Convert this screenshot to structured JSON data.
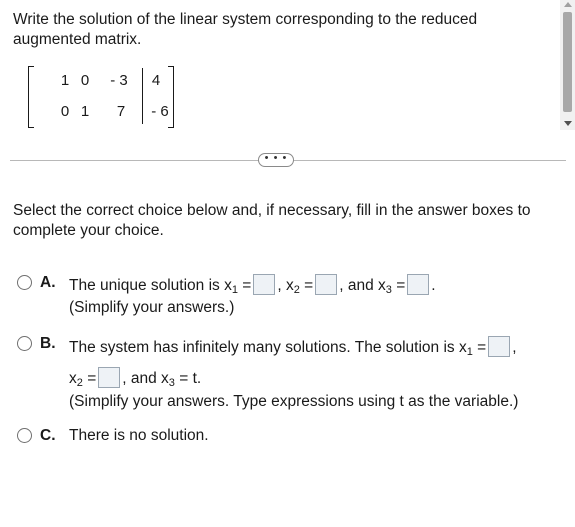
{
  "question": "Write the solution of the linear system corresponding to the reduced augmented matrix.",
  "matrix": {
    "rows": [
      [
        "1",
        "0",
        "- 3",
        "4"
      ],
      [
        "0",
        "1",
        "7",
        "- 6"
      ]
    ]
  },
  "more_button": "• • •",
  "instruction": "Select the correct choice below and, if necessary, fill in the answer boxes to complete your choice.",
  "choices": {
    "a": {
      "label": "A.",
      "text_1": "The unique solution is x",
      "sub_1": "1",
      "eq": "=",
      "x2": "x",
      "sub_2": "2",
      "and": "and x",
      "sub_3": "3",
      "hint": "(Simplify your answers.)"
    },
    "b": {
      "label": "B.",
      "text_1": "The system has infinitely many solutions. The solution is x",
      "sub_1": "1",
      "x2": "x",
      "sub_2": "2",
      "and": "and x",
      "sub_3": "3",
      "t_eq": "= t.",
      "hint": "(Simplify your answers. Type expressions using t as the variable.)"
    },
    "c": {
      "label": "C.",
      "text": "There is no solution."
    }
  }
}
